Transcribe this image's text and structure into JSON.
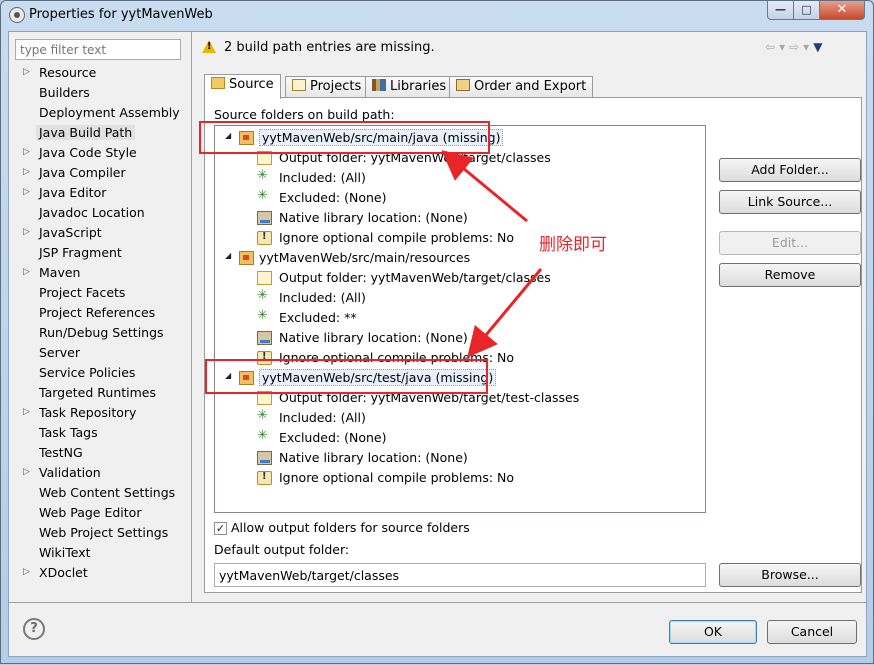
{
  "window": {
    "title": "Properties for yytMavenWeb"
  },
  "filter": {
    "placeholder": "type filter text"
  },
  "nav": {
    "items": [
      {
        "label": "Resource",
        "expandable": true
      },
      {
        "label": "Builders",
        "expandable": false
      },
      {
        "label": "Deployment Assembly",
        "expandable": false
      },
      {
        "label": "Java Build Path",
        "expandable": false,
        "selected": true
      },
      {
        "label": "Java Code Style",
        "expandable": true
      },
      {
        "label": "Java Compiler",
        "expandable": true
      },
      {
        "label": "Java Editor",
        "expandable": true
      },
      {
        "label": "Javadoc Location",
        "expandable": false
      },
      {
        "label": "JavaScript",
        "expandable": true
      },
      {
        "label": "JSP Fragment",
        "expandable": false
      },
      {
        "label": "Maven",
        "expandable": true
      },
      {
        "label": "Project Facets",
        "expandable": false
      },
      {
        "label": "Project References",
        "expandable": false
      },
      {
        "label": "Run/Debug Settings",
        "expandable": false
      },
      {
        "label": "Server",
        "expandable": false
      },
      {
        "label": "Service Policies",
        "expandable": false
      },
      {
        "label": "Targeted Runtimes",
        "expandable": false
      },
      {
        "label": "Task Repository",
        "expandable": true
      },
      {
        "label": "Task Tags",
        "expandable": false
      },
      {
        "label": "TestNG",
        "expandable": false
      },
      {
        "label": "Validation",
        "expandable": true
      },
      {
        "label": "Web Content Settings",
        "expandable": false
      },
      {
        "label": "Web Page Editor",
        "expandable": false
      },
      {
        "label": "Web Project Settings",
        "expandable": false
      },
      {
        "label": "WikiText",
        "expandable": false
      },
      {
        "label": "XDoclet",
        "expandable": true
      }
    ]
  },
  "message": {
    "text": "2 build path entries are missing."
  },
  "tabs": [
    {
      "label": "Source",
      "active": true
    },
    {
      "label": "Projects"
    },
    {
      "label": "Libraries"
    },
    {
      "label": "Order and Export"
    }
  ],
  "source": {
    "label": "Source folders on build path:",
    "tree": [
      {
        "label": "yytMavenWeb/src/main/java (missing)",
        "level": 0,
        "icon": "missing-source-folder-icon",
        "selected": true
      },
      {
        "label": "Output folder: yytMavenWeb/target/classes",
        "level": 1,
        "icon": "output-folder-icon"
      },
      {
        "label": "Included: (All)",
        "level": 1,
        "icon": "filter-icon"
      },
      {
        "label": "Excluded: (None)",
        "level": 1,
        "icon": "filter-icon"
      },
      {
        "label": "Native library location: (None)",
        "level": 1,
        "icon": "native-library-icon"
      },
      {
        "label": "Ignore optional compile problems: No",
        "level": 1,
        "icon": "ignore-problems-icon"
      },
      {
        "label": "yytMavenWeb/src/main/resources",
        "level": 0,
        "icon": "source-folder-icon"
      },
      {
        "label": "Output folder: yytMavenWeb/target/classes",
        "level": 1,
        "icon": "output-folder-icon"
      },
      {
        "label": "Included: (All)",
        "level": 1,
        "icon": "filter-icon"
      },
      {
        "label": "Excluded: **",
        "level": 1,
        "icon": "filter-icon"
      },
      {
        "label": "Native library location: (None)",
        "level": 1,
        "icon": "native-library-icon"
      },
      {
        "label": "Ignore optional compile problems: No",
        "level": 1,
        "icon": "ignore-problems-icon"
      },
      {
        "label": "yytMavenWeb/src/test/java (missing)",
        "level": 0,
        "icon": "missing-source-folder-icon",
        "selected": true
      },
      {
        "label": "Output folder: yytMavenWeb/target/test-classes",
        "level": 1,
        "icon": "output-folder-icon"
      },
      {
        "label": "Included: (All)",
        "level": 1,
        "icon": "filter-icon"
      },
      {
        "label": "Excluded: (None)",
        "level": 1,
        "icon": "filter-icon"
      },
      {
        "label": "Native library location: (None)",
        "level": 1,
        "icon": "native-library-icon"
      },
      {
        "label": "Ignore optional compile problems: No",
        "level": 1,
        "icon": "ignore-problems-icon"
      }
    ],
    "buttons": {
      "add_folder": "Add Folder...",
      "link_source": "Link Source...",
      "edit": "Edit...",
      "remove": "Remove",
      "browse": "Browse..."
    },
    "allow_output": {
      "label": "Allow output folders for source folders",
      "checked": true
    },
    "default_output": {
      "label": "Default output folder:",
      "value": "yytMavenWeb/target/classes"
    }
  },
  "footer": {
    "ok": "OK",
    "cancel": "Cancel"
  },
  "annotation": {
    "text": "删除即可",
    "color": "#e8262a"
  }
}
